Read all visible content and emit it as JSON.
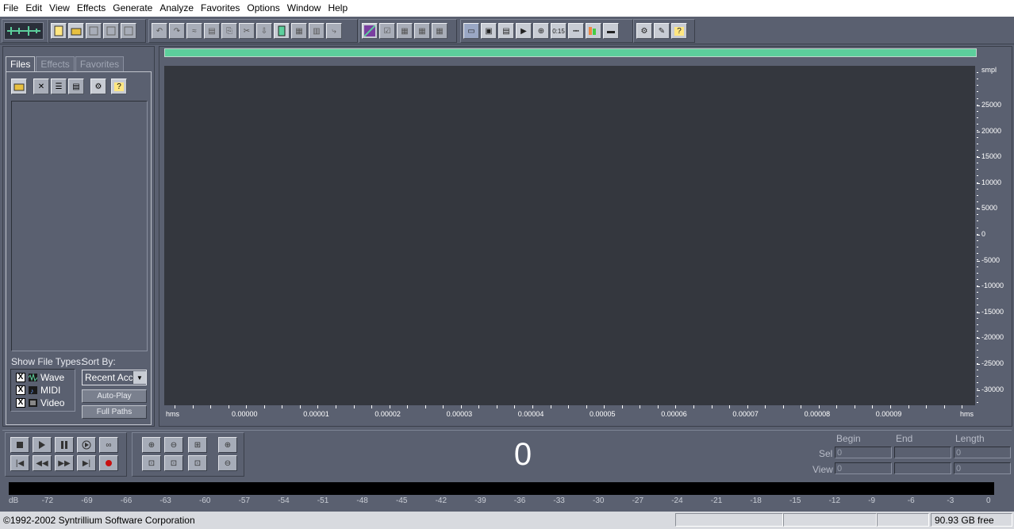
{
  "menu": [
    "File",
    "Edit",
    "View",
    "Effects",
    "Generate",
    "Analyze",
    "Favorites",
    "Options",
    "Window",
    "Help"
  ],
  "toolbar": {
    "groups": [
      {
        "name": "file",
        "icons": [
          "new-file-icon",
          "open-file-icon",
          "save-icon",
          "save-all-icon",
          "close-file-icon"
        ]
      },
      {
        "name": "edit",
        "icons": [
          "undo-icon",
          "redo-icon",
          "repeat-icon",
          "copy-to-new-icon",
          "copy-icon",
          "cut-icon",
          "paste-icon",
          "paste-new-icon",
          "mix-paste-icon",
          "trim-icon",
          "crop-icon"
        ]
      },
      {
        "name": "multitrack",
        "icons": [
          "multitrack-icon",
          "check-icon",
          "grid-icon",
          "grid2-icon",
          "grid3-icon"
        ]
      },
      {
        "name": "view",
        "icons": [
          "wave-view-icon",
          "spectral-view-icon",
          "loop-icon",
          "play-icon",
          "zoom-icon",
          "time-icon",
          "frames-icon",
          "levels-icon",
          "status-icon"
        ]
      },
      {
        "name": "settings",
        "icons": [
          "settings-icon",
          "tools-icon",
          "help-icon"
        ]
      }
    ],
    "time_label": "0:15"
  },
  "left_panel": {
    "tabs": [
      "Files",
      "Effects",
      "Favorites"
    ],
    "show_file_types_label": "Show File Types:",
    "sort_by_label": "Sort By:",
    "sort_value": "Recent Acc",
    "types": [
      {
        "label": "Wave",
        "checked": "X"
      },
      {
        "label": "MIDI",
        "checked": "X"
      },
      {
        "label": "Video",
        "checked": "X"
      }
    ],
    "auto_play_label": "Auto-Play",
    "full_paths_label": "Full Paths"
  },
  "wave": {
    "y_unit": "smpl",
    "y_labels": [
      "25000",
      "20000",
      "15000",
      "10000",
      "5000",
      "0",
      "-5000",
      "-10000",
      "-15000",
      "-20000",
      "-25000",
      "-30000"
    ],
    "x_unit_left": "hms",
    "x_unit_right": "hms",
    "x_labels": [
      "0.00000",
      "0.00001",
      "0.00002",
      "0.00003",
      "0.00004",
      "0.00005",
      "0.00006",
      "0.00007",
      "0.00008",
      "0.00009"
    ]
  },
  "time_display": "0",
  "selection": {
    "headers": [
      "Begin",
      "End",
      "Length"
    ],
    "sel_label": "Sel",
    "view_label": "View",
    "sel_values": [
      "0",
      "",
      "0"
    ],
    "view_values": [
      "0",
      "",
      "0"
    ]
  },
  "meter": {
    "labels": [
      "dB",
      "-72",
      "-69",
      "-66",
      "-63",
      "-60",
      "-57",
      "-54",
      "-51",
      "-48",
      "-45",
      "-42",
      "-39",
      "-36",
      "-33",
      "-30",
      "-27",
      "-24",
      "-21",
      "-18",
      "-15",
      "-12",
      "-9",
      "-6",
      "-3",
      "0"
    ]
  },
  "status": {
    "copyright": "©1992-2002 Syntrillium Software Corporation",
    "free_space": "90.93 GB free"
  },
  "colors": {
    "background": "#5a6070",
    "wave_bg": "#34373e",
    "overview": "#5ccf9c"
  }
}
